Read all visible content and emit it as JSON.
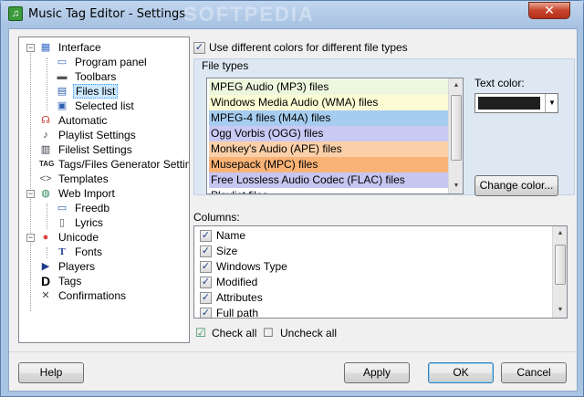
{
  "window": {
    "title": "Music Tag Editor - Settings",
    "close_label": "✕",
    "watermark": "SOFTPEDIA"
  },
  "tree": {
    "items": [
      {
        "label": "Interface",
        "icon": "interface-icon"
      },
      {
        "label": "Program panel",
        "icon": "program-panel-icon"
      },
      {
        "label": "Toolbars",
        "icon": "toolbars-icon"
      },
      {
        "label": "Files list",
        "icon": "files-list-icon"
      },
      {
        "label": "Selected list",
        "icon": "selected-list-icon"
      },
      {
        "label": "Automatic",
        "icon": "automatic-icon"
      },
      {
        "label": "Playlist Settings",
        "icon": "playlist-icon"
      },
      {
        "label": "Filelist Settings",
        "icon": "filelist-icon"
      },
      {
        "label": "Tags/Files Generator Settings",
        "icon": "tag-generator-icon"
      },
      {
        "label": "Templates",
        "icon": "templates-icon"
      },
      {
        "label": "Web Import",
        "icon": "web-import-icon"
      },
      {
        "label": "Freedb",
        "icon": "freedb-icon"
      },
      {
        "label": "Lyrics",
        "icon": "lyrics-icon"
      },
      {
        "label": "Unicode",
        "icon": "unicode-icon"
      },
      {
        "label": "Fonts",
        "icon": "fonts-icon"
      },
      {
        "label": "Players",
        "icon": "players-icon"
      },
      {
        "label": "Tags",
        "icon": "tags-icon"
      },
      {
        "label": "Confirmations",
        "icon": "confirmations-icon"
      }
    ]
  },
  "options": {
    "use_colors_label": "Use different colors for different file types",
    "use_colors_checked": "✓",
    "file_types_label": "File types",
    "text_color_label": "Text color:",
    "text_color_value": "#1f1f1f",
    "change_color_label": "Change color..."
  },
  "file_types": [
    {
      "label": "MPEG Audio (MP3) files",
      "color": "#edf7dd"
    },
    {
      "label": "Windows Media Audio (WMA) files",
      "color": "#fbfbd4"
    },
    {
      "label": "MPEG-4 files (M4A) files",
      "color": "#a6cdf0"
    },
    {
      "label": "Ogg Vorbis (OGG) files",
      "color": "#c9c9f4"
    },
    {
      "label": "Monkey's Audio (APE) files",
      "color": "#fbd0a8"
    },
    {
      "label": "Musepack (MPC) files",
      "color": "#f9b377"
    },
    {
      "label": "Free Lossless Audio Codec (FLAC) files",
      "color": "#c6c6f1"
    },
    {
      "label": "Playlist files",
      "color": "#ffffff"
    }
  ],
  "columns": {
    "label": "Columns:",
    "items": [
      {
        "label": "Name",
        "check": "✓"
      },
      {
        "label": "Size",
        "check": "✓"
      },
      {
        "label": "Windows Type",
        "check": "✓"
      },
      {
        "label": "Modified",
        "check": "✓"
      },
      {
        "label": "Attributes",
        "check": "✓"
      },
      {
        "label": "Full path",
        "check": "✓"
      }
    ],
    "check_all_label": "Check all",
    "uncheck_all_label": "Uncheck all"
  },
  "buttons": {
    "help": "Help",
    "apply": "Apply",
    "ok": "OK",
    "cancel": "Cancel"
  }
}
